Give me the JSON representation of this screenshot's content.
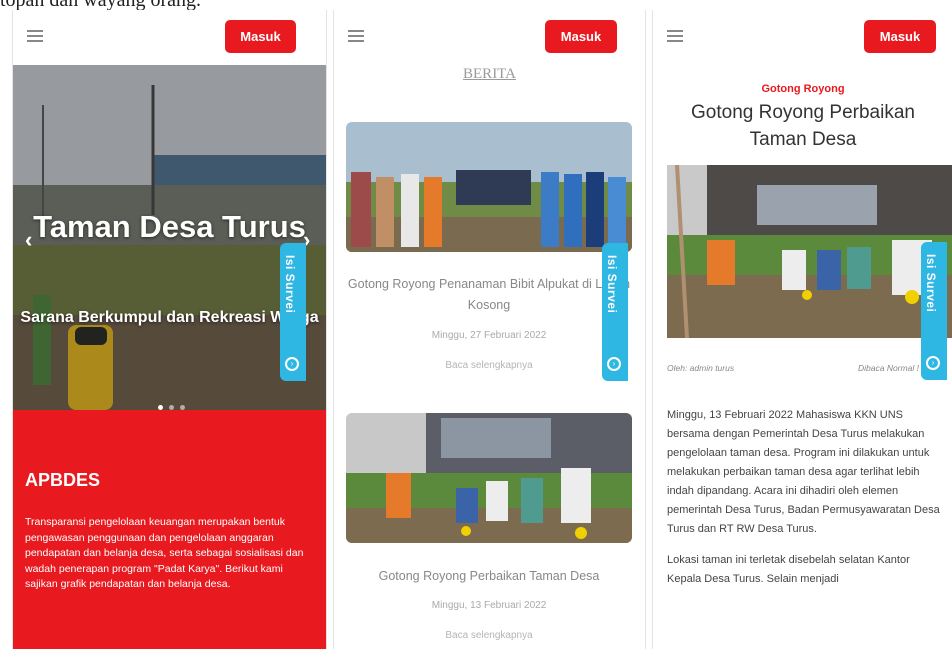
{
  "caption": "topan dan wayang orang.",
  "nav": {
    "login_label": "Masuk"
  },
  "survey": {
    "label": "Isi Survei"
  },
  "home": {
    "hero_title": "Taman Desa Turus",
    "hero_subtitle": "Sarana Berkumpul dan Rekreasi Warga",
    "apbdes_title": "APBDES",
    "apbdes_text": "Transparansi pengelolaan keuangan merupakan bentuk pengawasan penggunaan dan pengelolaan anggaran pendapatan dan belanja desa, serta sebagai sosialisasi dan wadah penerapan program \"Padat Karya\". Berikut kami sajikan grafik pendapatan dan belanja desa."
  },
  "news": {
    "header": "BERITA",
    "items": [
      {
        "title": "Gotong Royong Penanaman Bibit Alpukat di Lahan Kosong",
        "date": "Minggu, 27 Februari 2022",
        "read_more": "Baca selengkapnya"
      },
      {
        "title": "Gotong Royong Perbaikan Taman Desa",
        "date": "Minggu, 13 Februari 2022",
        "read_more": "Baca selengkapnya"
      }
    ]
  },
  "article": {
    "category": "Gotong Royong",
    "title": "Gotong Royong Perbaikan Taman Desa",
    "author": "Oleh: admin turus",
    "views": "Dibaca Normal !",
    "paragraphs": [
      "Minggu, 13 Februari 2022 Mahasiswa KKN UNS bersama dengan Pemerintah Desa Turus melakukan pengelolaan taman desa. Program ini dilakukan untuk melakukan perbaikan taman desa agar terlihat lebih indah dipandang. Acara ini dihadiri oleh elemen pemerintah Desa Turus, Badan Permusyawaratan Desa Turus dan RT RW Desa Turus.",
      "Lokasi taman ini terletak disebelah selatan Kantor Kepala Desa Turus. Selain menjadi"
    ]
  },
  "colors": {
    "brand_red": "#e8191f",
    "survey_blue": "#2fb7e3"
  },
  "icons": [
    "hamburger-icon",
    "chevron-left-icon",
    "chevron-right-icon",
    "survey-icon"
  ]
}
